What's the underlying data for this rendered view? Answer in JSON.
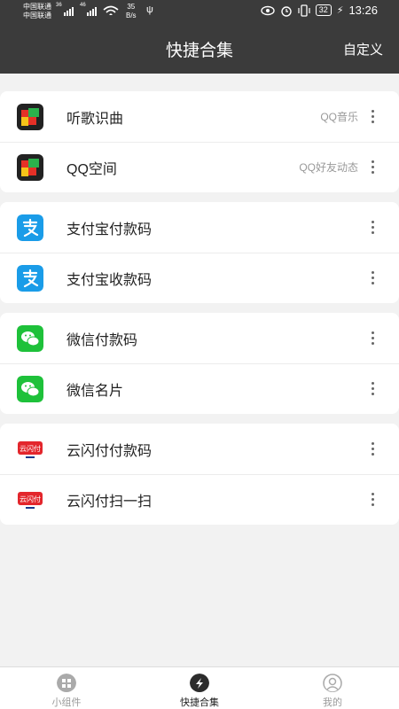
{
  "status_bar": {
    "carrier_1": "中国联通",
    "carrier_2": "中国联通",
    "net_1": "36",
    "net_2": "46",
    "speed_value": "35",
    "speed_unit": "B/s",
    "battery": "32",
    "time": "13:26"
  },
  "header": {
    "title": "快捷合集",
    "action": "自定义"
  },
  "groups": [
    {
      "items": [
        {
          "label": "听歌识曲",
          "sub": "QQ音乐",
          "icon": "qq-music-icon"
        },
        {
          "label": "QQ空间",
          "sub": "QQ好友动态",
          "icon": "qq-music-icon"
        }
      ]
    },
    {
      "items": [
        {
          "label": "支付宝付款码",
          "sub": "",
          "icon": "alipay-icon"
        },
        {
          "label": "支付宝收款码",
          "sub": "",
          "icon": "alipay-icon"
        }
      ]
    },
    {
      "items": [
        {
          "label": "微信付款码",
          "sub": "",
          "icon": "wechat-icon"
        },
        {
          "label": "微信名片",
          "sub": "",
          "icon": "wechat-icon"
        }
      ]
    },
    {
      "items": [
        {
          "label": "云闪付付款码",
          "sub": "",
          "icon": "unionpay-icon"
        },
        {
          "label": "云闪付扫一扫",
          "sub": "",
          "icon": "unionpay-icon"
        }
      ]
    }
  ],
  "unionpay_logo_text": "云闪付",
  "bottom_nav": [
    {
      "label": "小组件",
      "icon": "widget-icon",
      "active": false
    },
    {
      "label": "快捷合集",
      "icon": "shortcut-icon",
      "active": true
    },
    {
      "label": "我的",
      "icon": "profile-icon",
      "active": false
    }
  ],
  "colors": {
    "header_bg": "#3b3b3b",
    "page_bg": "#f2f2f2",
    "alipay_blue": "#1a9ce8",
    "wechat_green": "#1ec13a",
    "unionpay_red": "#e3262c"
  }
}
